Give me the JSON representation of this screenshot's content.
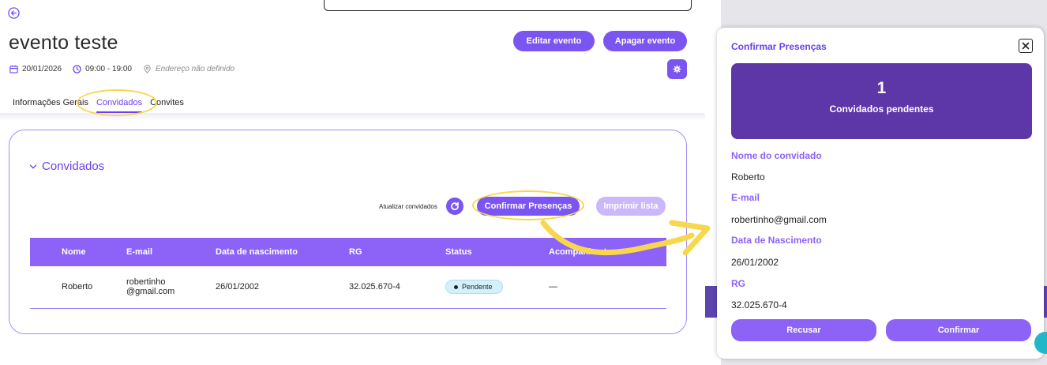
{
  "event": {
    "title": "evento teste",
    "date": "20/01/2026",
    "time": "09:00 - 19:00",
    "address": "Endereço não definido"
  },
  "header_buttons": {
    "edit": "Editar evento",
    "delete": "Apagar evento"
  },
  "tabs": [
    {
      "label": "Informações Gerais",
      "active": false
    },
    {
      "label": "Convidados",
      "active": true
    },
    {
      "label": "Convites",
      "active": false
    }
  ],
  "section": {
    "title": "Convidados",
    "refresh_label": "Atualizar convidados",
    "confirm_button": "Confirmar Presenças",
    "print_button": "Imprimir lista"
  },
  "table": {
    "headers": [
      "Nome",
      "E-mail",
      "Data de nascimento",
      "RG",
      "Status",
      "Acompanhantes"
    ],
    "rows": [
      {
        "nome": "Roberto",
        "email_line1": "robertinho",
        "email_line2": "@gmail.com",
        "nascimento": "26/01/2002",
        "rg": "32.025.670-4",
        "status": "Pendente",
        "acompanhantes": "—"
      }
    ]
  },
  "modal": {
    "title": "Confirmar Presenças",
    "pending_count": "1",
    "pending_label": "Convidados pendentes",
    "fields": [
      {
        "label": "Nome do convidado",
        "value": "Roberto"
      },
      {
        "label": "E-mail",
        "value": "robertinho@gmail.com"
      },
      {
        "label": "Data de Nascimento",
        "value": "26/01/2002"
      },
      {
        "label": "RG",
        "value": "32.025.670-4"
      }
    ],
    "reject_button": "Recusar",
    "confirm_button": "Confirmar"
  },
  "colors": {
    "primary": "#7b55f2",
    "modal_summary": "#5d36a8",
    "highlight": "#f7d74e",
    "badge_bg": "#d3f0fb"
  }
}
